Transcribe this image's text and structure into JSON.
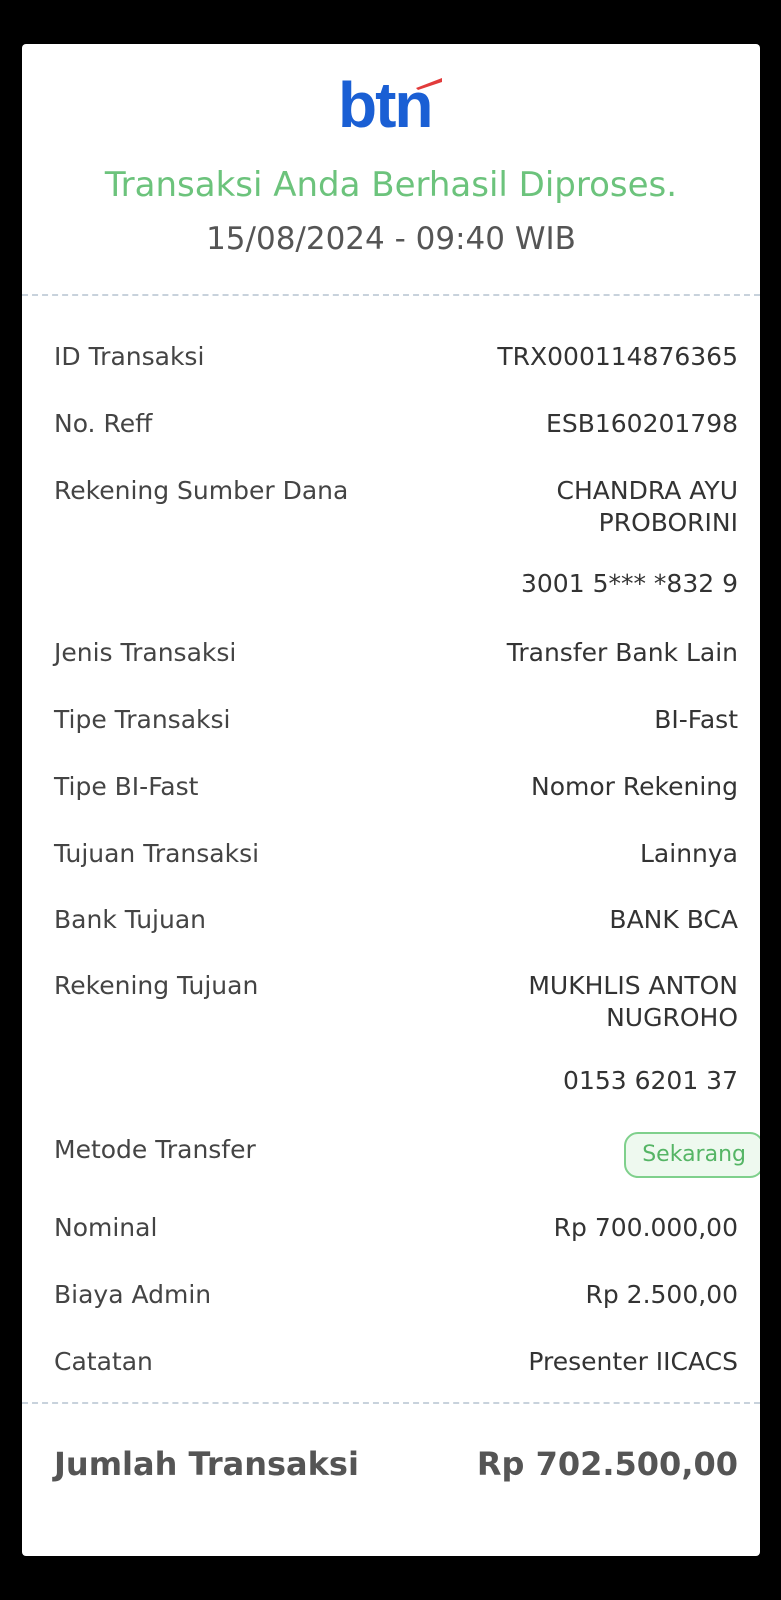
{
  "header": {
    "logo_text": "btn",
    "status_message": "Transaksi Anda Berhasil Diproses.",
    "datetime": "15/08/2024 - 09:40 WIB"
  },
  "details": {
    "id_transaksi": {
      "label": "ID Transaksi",
      "value": "TRX000114876365"
    },
    "no_reff": {
      "label": "No. Reff",
      "value": "ESB160201798"
    },
    "rekening_sumber": {
      "label": "Rekening Sumber Dana",
      "name_line1": "CHANDRA AYU",
      "name_line2": "PROBORINI",
      "account": "3001 5*** *832 9"
    },
    "jenis_transaksi": {
      "label": "Jenis Transaksi",
      "value": "Transfer Bank Lain"
    },
    "tipe_transaksi": {
      "label": "Tipe Transaksi",
      "value": "BI-Fast"
    },
    "tipe_bifast": {
      "label": "Tipe BI-Fast",
      "value": "Nomor Rekening"
    },
    "tujuan_transaksi": {
      "label": "Tujuan Transaksi",
      "value": "Lainnya"
    },
    "bank_tujuan": {
      "label": "Bank Tujuan",
      "value": "BANK BCA"
    },
    "rekening_tujuan": {
      "label": "Rekening Tujuan",
      "name_line1": "MUKHLIS ANTON",
      "name_line2": "NUGROHO",
      "account": "0153 6201 37"
    },
    "metode_transfer": {
      "label": "Metode Transfer",
      "value": "Sekarang"
    },
    "nominal": {
      "label": "Nominal",
      "value": "Rp 700.000,00"
    },
    "biaya_admin": {
      "label": "Biaya Admin",
      "value": "Rp 2.500,00"
    },
    "catatan": {
      "label": "Catatan",
      "value": "Presenter IICACS"
    }
  },
  "total": {
    "label": "Jumlah Transaksi",
    "value": "Rp 702.500,00"
  },
  "colors": {
    "brand_blue": "#1a5fd4",
    "brand_red": "#e23b3b",
    "success_green": "#6cc37c"
  }
}
